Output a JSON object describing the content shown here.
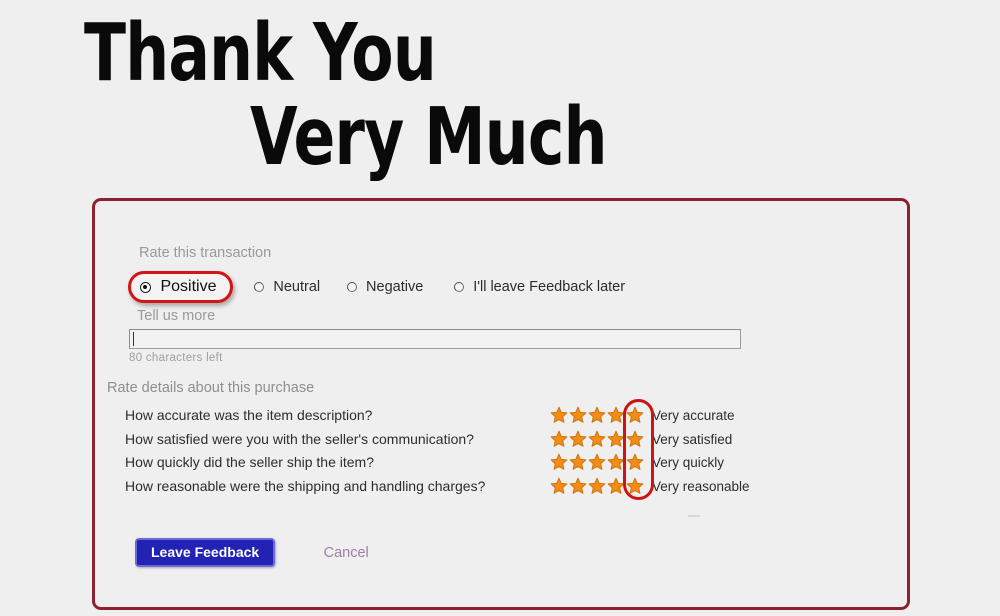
{
  "page": {
    "background_color": "#efefef"
  },
  "headline": {
    "line1": "Thank You",
    "line2": "Very Much"
  },
  "feedback_form": {
    "frame_color": "#8b2230",
    "rate_transaction": {
      "label": "Rate this transaction",
      "options": [
        {
          "label": "Positive",
          "selected": true,
          "highlighted": true
        },
        {
          "label": "Neutral",
          "selected": false,
          "highlighted": false
        },
        {
          "label": "Negative",
          "selected": false,
          "highlighted": false
        },
        {
          "label": "I'll leave Feedback later",
          "selected": false,
          "highlighted": false
        }
      ],
      "highlight_color": "#d31515"
    },
    "tell_us_more": {
      "label": "Tell us more",
      "value": "",
      "placeholder": "",
      "characters_left": "80 characters left"
    },
    "rate_details": {
      "label": "Rate details about this purchase",
      "star_color": "#f28c18",
      "max_stars": 5,
      "highlight_color": "#cc1414",
      "rows": [
        {
          "question": "How accurate was the item description?",
          "stars": 5,
          "value_label": "Very accurate"
        },
        {
          "question": "How satisfied were you with the seller's communication?",
          "stars": 5,
          "value_label": "Very satisfied"
        },
        {
          "question": "How quickly did the seller ship the item?",
          "stars": 5,
          "value_label": "Very quickly"
        },
        {
          "question": "How reasonable were the shipping and handling charges?",
          "stars": 5,
          "value_label": "Very reasonable"
        }
      ]
    },
    "actions": {
      "submit_label": "Leave Feedback",
      "submit_color": "#2222b4",
      "cancel_label": "Cancel",
      "cancel_color": "#9d80a4"
    }
  }
}
